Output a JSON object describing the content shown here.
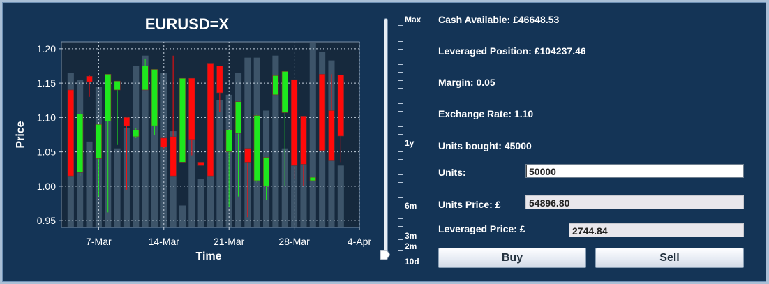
{
  "chart_data": {
    "type": "candlestick",
    "title": "EURUSD=X",
    "xlabel": "Time",
    "ylabel": "Price",
    "ylim": [
      0.94,
      1.21
    ],
    "yticks": [
      0.95,
      1.0,
      1.05,
      1.1,
      1.15,
      1.2
    ],
    "ytick_labels": [
      "0.95",
      "1.00",
      "1.05",
      "1.10",
      "1.15",
      "1.20"
    ],
    "x_range": [
      3,
      35
    ],
    "xticks": [
      {
        "x": 7,
        "label": "7-Mar"
      },
      {
        "x": 14,
        "label": "14-Mar"
      },
      {
        "x": 21,
        "label": "21-Mar"
      },
      {
        "x": 28,
        "label": "28-Mar"
      },
      {
        "x": 35,
        "label": "4-Apr"
      }
    ],
    "grid": true,
    "rising_color": "#1ee81e",
    "falling_color": "#ff0a0a",
    "volume_color": "#3d5469",
    "candles": [
      {
        "x": 4,
        "open": 1.14,
        "close": 1.015,
        "high": 1.14,
        "low": 1.015
      },
      {
        "x": 5,
        "open": 1.02,
        "close": 1.105,
        "high": 1.11,
        "low": 1.015
      },
      {
        "x": 6,
        "open": 1.16,
        "close": 1.152,
        "high": 1.162,
        "low": 1.13
      },
      {
        "x": 7,
        "open": 1.04,
        "close": 1.09,
        "high": 1.09,
        "low": 0.985
      },
      {
        "x": 8,
        "open": 1.095,
        "close": 1.163,
        "high": 1.163,
        "low": 0.962
      },
      {
        "x": 9,
        "open": 1.14,
        "close": 1.153,
        "high": 1.153,
        "low": 1.06
      },
      {
        "x": 10,
        "open": 1.1,
        "close": 1.088,
        "high": 1.1,
        "low": 0.995
      },
      {
        "x": 11,
        "open": 1.072,
        "close": 1.082,
        "high": 1.084,
        "low": 1.07
      },
      {
        "x": 12,
        "open": 1.14,
        "close": 1.175,
        "high": 1.185,
        "low": 1.14
      },
      {
        "x": 13,
        "open": 1.088,
        "close": 1.17,
        "high": 1.17,
        "low": 1.075
      },
      {
        "x": 14,
        "open": 1.07,
        "close": 1.057,
        "high": 1.07,
        "low": 1.055
      },
      {
        "x": 15,
        "open": 1.072,
        "close": 1.015,
        "high": 1.19,
        "low": 1.015
      },
      {
        "x": 16,
        "open": 1.035,
        "close": 1.157,
        "high": 1.157,
        "low": 1.035
      },
      {
        "x": 17,
        "open": 1.157,
        "close": 1.068,
        "high": 1.157,
        "low": 1.045
      },
      {
        "x": 18,
        "open": 1.035,
        "close": 1.03,
        "high": 1.035,
        "low": 1.03
      },
      {
        "x": 19,
        "open": 1.178,
        "close": 1.015,
        "high": 1.178,
        "low": 1.015
      },
      {
        "x": 20,
        "open": 1.175,
        "close": 1.136,
        "high": 1.175,
        "low": 1.108
      },
      {
        "x": 21,
        "open": 1.05,
        "close": 1.082,
        "high": 1.082,
        "low": 0.97
      },
      {
        "x": 22,
        "open": 1.077,
        "close": 1.123,
        "high": 1.123,
        "low": 0.985
      },
      {
        "x": 23,
        "open": 1.055,
        "close": 1.035,
        "high": 1.055,
        "low": 0.955
      },
      {
        "x": 24,
        "open": 1.008,
        "close": 1.103,
        "high": 1.105,
        "low": 1.005
      },
      {
        "x": 25,
        "open": 1.0,
        "close": 1.042,
        "high": 1.042,
        "low": 0.98
      },
      {
        "x": 26,
        "open": 1.133,
        "close": 1.161,
        "high": 1.161,
        "low": 1.133
      },
      {
        "x": 27,
        "open": 1.107,
        "close": 1.167,
        "high": 1.167,
        "low": 1.0
      },
      {
        "x": 28,
        "open": 1.155,
        "close": 1.03,
        "high": 1.155,
        "low": 1.01
      },
      {
        "x": 29,
        "open": 1.102,
        "close": 1.032,
        "high": 1.102,
        "low": 1.0
      },
      {
        "x": 30,
        "open": 1.008,
        "close": 1.013,
        "high": 1.013,
        "low": 1.008
      },
      {
        "x": 31,
        "open": 1.163,
        "close": 1.052,
        "high": 1.163,
        "low": 1.05
      },
      {
        "x": 32,
        "open": 1.11,
        "close": 1.037,
        "high": 1.163,
        "low": 1.037
      },
      {
        "x": 33,
        "open": 1.162,
        "close": 1.073,
        "high": 1.162,
        "low": 1.035
      }
    ],
    "volume": [
      {
        "x": 4,
        "v": 1.165
      },
      {
        "x": 5,
        "v": 1.155
      },
      {
        "x": 6,
        "v": 1.065
      },
      {
        "x": 7,
        "v": 1.145
      },
      {
        "x": 8,
        "v": 1.1
      },
      {
        "x": 9,
        "v": 1.055
      },
      {
        "x": 10,
        "v": 1.085
      },
      {
        "x": 11,
        "v": 1.175
      },
      {
        "x": 12,
        "v": 1.19
      },
      {
        "x": 13,
        "v": 1.15
      },
      {
        "x": 14,
        "v": 1.165
      },
      {
        "x": 15,
        "v": 1.08
      },
      {
        "x": 16,
        "v": 0.972
      },
      {
        "x": 17,
        "v": 1.125
      },
      {
        "x": 18,
        "v": 1.01
      },
      {
        "x": 19,
        "v": 1.125
      },
      {
        "x": 20,
        "v": 1.125
      },
      {
        "x": 21,
        "v": 1.133
      },
      {
        "x": 22,
        "v": 1.165
      },
      {
        "x": 23,
        "v": 1.187
      },
      {
        "x": 24,
        "v": 1.187
      },
      {
        "x": 25,
        "v": 1.11
      },
      {
        "x": 26,
        "v": 1.19
      },
      {
        "x": 27,
        "v": 1.055
      },
      {
        "x": 28,
        "v": 1.145
      },
      {
        "x": 29,
        "v": 1.085
      },
      {
        "x": 30,
        "v": 1.208
      },
      {
        "x": 31,
        "v": 1.195
      },
      {
        "x": 32,
        "v": 1.183
      },
      {
        "x": 33,
        "v": 1.03
      }
    ]
  },
  "slider": {
    "labels": {
      "max": "Max",
      "y1": "1y",
      "m6": "6m",
      "m3": "3m",
      "m2": "2m",
      "d10": "10d"
    },
    "selected": "10d"
  },
  "info": {
    "cash": "Cash Available: £46648.53",
    "leveraged_position": "Leveraged Position: £104237.46",
    "margin": "Margin: 0.05",
    "exchange_rate": "Exchange Rate: 1.10",
    "units_bought": "Units bought: 45000"
  },
  "form": {
    "units_label": "Units:",
    "units_value": "50000",
    "units_price_label": "Units Price: £",
    "units_price_value": "54896.80",
    "leveraged_price_label": "Leveraged Price: £",
    "leveraged_price_value": "2744.84"
  },
  "actions": {
    "buy": "Buy",
    "sell": "Sell"
  }
}
